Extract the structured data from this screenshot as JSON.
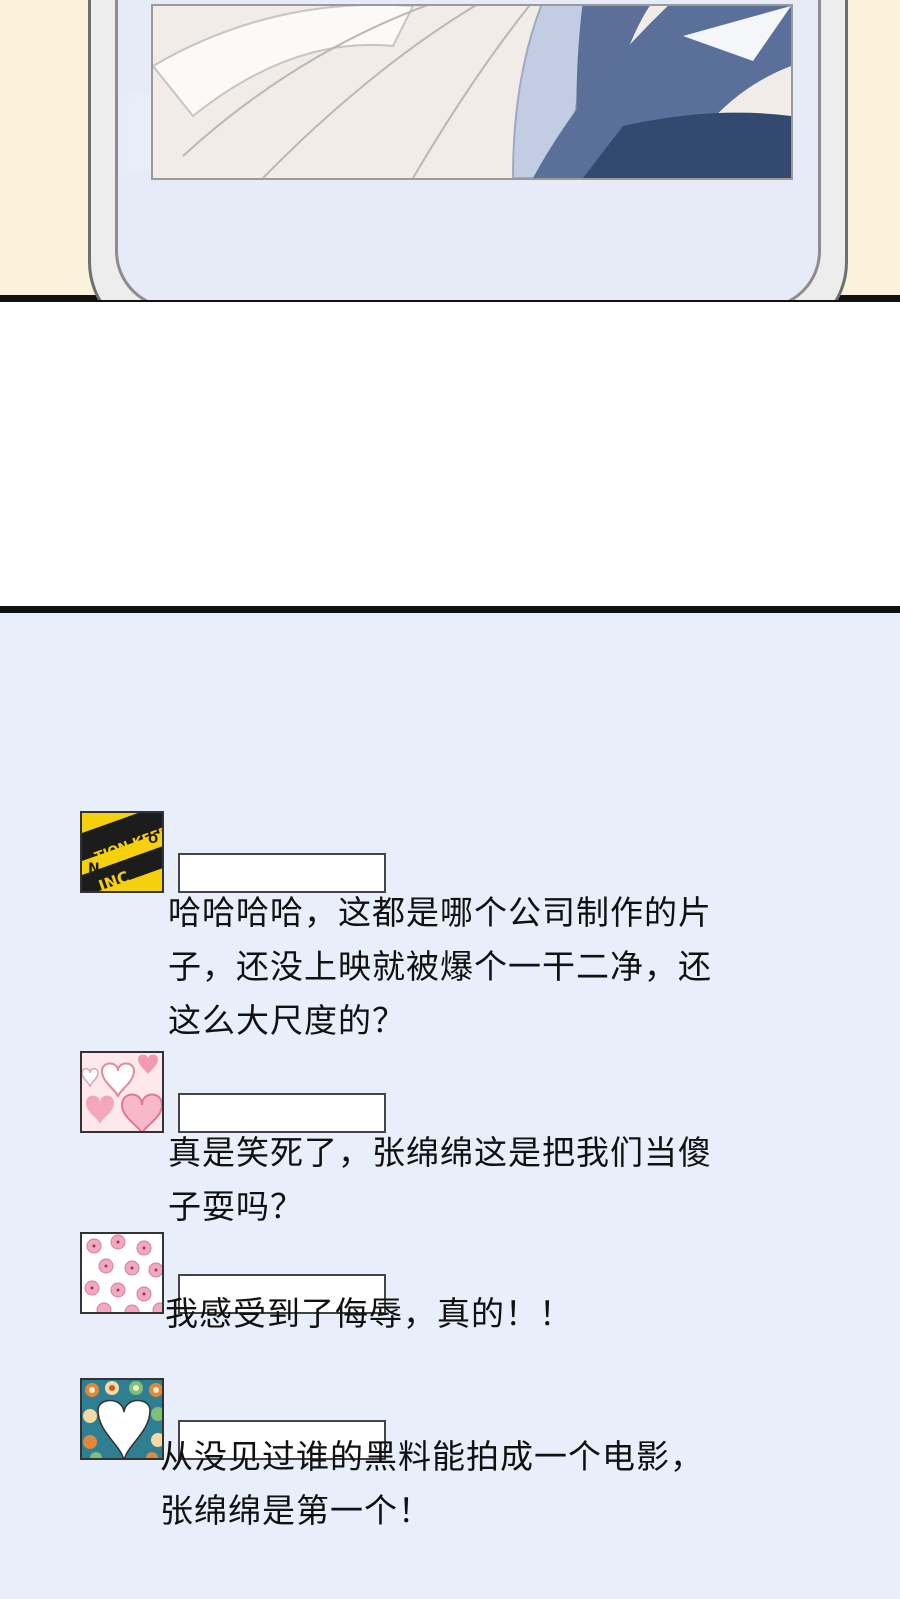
{
  "comments": [
    {
      "avatar_icon": "caution-tape-avatar-icon",
      "name": "",
      "text": [
        "哈哈哈哈，这都是哪个公司制作的片",
        "子，还没上映就被爆个一干二净，还",
        "这么大尺度的？"
      ]
    },
    {
      "avatar_icon": "hearts-avatar-icon",
      "name": "",
      "text": [
        "真是笑死了，张绵绵这是把我们当傻",
        "子耍吗？"
      ]
    },
    {
      "avatar_icon": "cherry-blossom-avatar-icon",
      "name": "",
      "text": [
        "我感受到了侮辱，真的！！"
      ]
    },
    {
      "avatar_icon": "flower-heart-avatar-icon",
      "name": "",
      "text": [
        "从没见过谁的黑料能拍成一个电影，",
        "张绵绵是第一个！"
      ]
    }
  ],
  "caution_tape": {
    "line1": "TION KEEP",
    "line2": "N",
    "line3": "K",
    "line4": "INC",
    "line5": "O"
  },
  "colors": {
    "comment_bg": "#e8eefa",
    "top_bg": "#fbf2dc",
    "phone_screen": "#e6ebf7"
  }
}
